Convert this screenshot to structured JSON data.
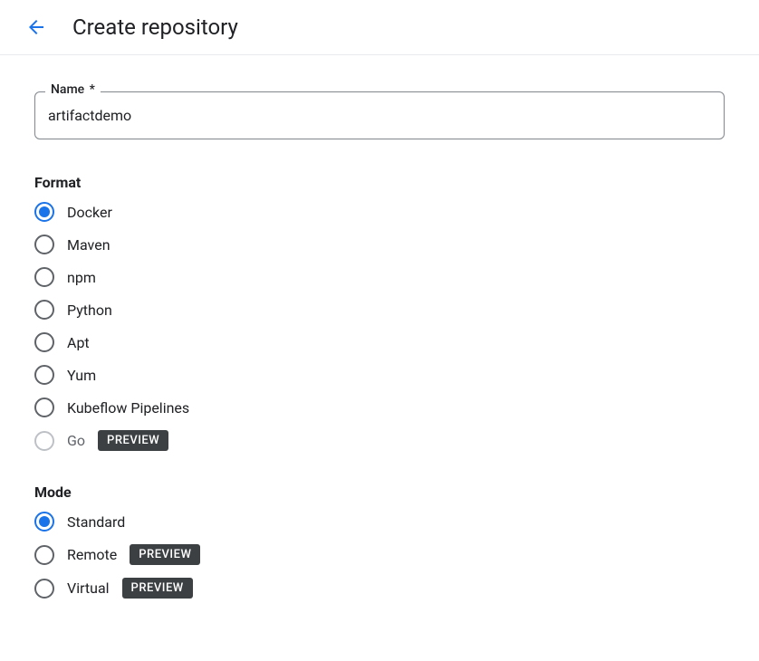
{
  "header": {
    "title": "Create repository"
  },
  "nameField": {
    "label": "Name",
    "required": "*",
    "value": "artifactdemo"
  },
  "format": {
    "label": "Format",
    "options": [
      {
        "label": "Docker",
        "selected": true,
        "disabled": false,
        "badge": null
      },
      {
        "label": "Maven",
        "selected": false,
        "disabled": false,
        "badge": null
      },
      {
        "label": "npm",
        "selected": false,
        "disabled": false,
        "badge": null
      },
      {
        "label": "Python",
        "selected": false,
        "disabled": false,
        "badge": null
      },
      {
        "label": "Apt",
        "selected": false,
        "disabled": false,
        "badge": null
      },
      {
        "label": "Yum",
        "selected": false,
        "disabled": false,
        "badge": null
      },
      {
        "label": "Kubeflow Pipelines",
        "selected": false,
        "disabled": false,
        "badge": null
      },
      {
        "label": "Go",
        "selected": false,
        "disabled": true,
        "badge": "PREVIEW"
      }
    ]
  },
  "mode": {
    "label": "Mode",
    "options": [
      {
        "label": "Standard",
        "selected": true,
        "disabled": false,
        "badge": null
      },
      {
        "label": "Remote",
        "selected": false,
        "disabled": false,
        "badge": "PREVIEW"
      },
      {
        "label": "Virtual",
        "selected": false,
        "disabled": false,
        "badge": "PREVIEW"
      }
    ]
  }
}
